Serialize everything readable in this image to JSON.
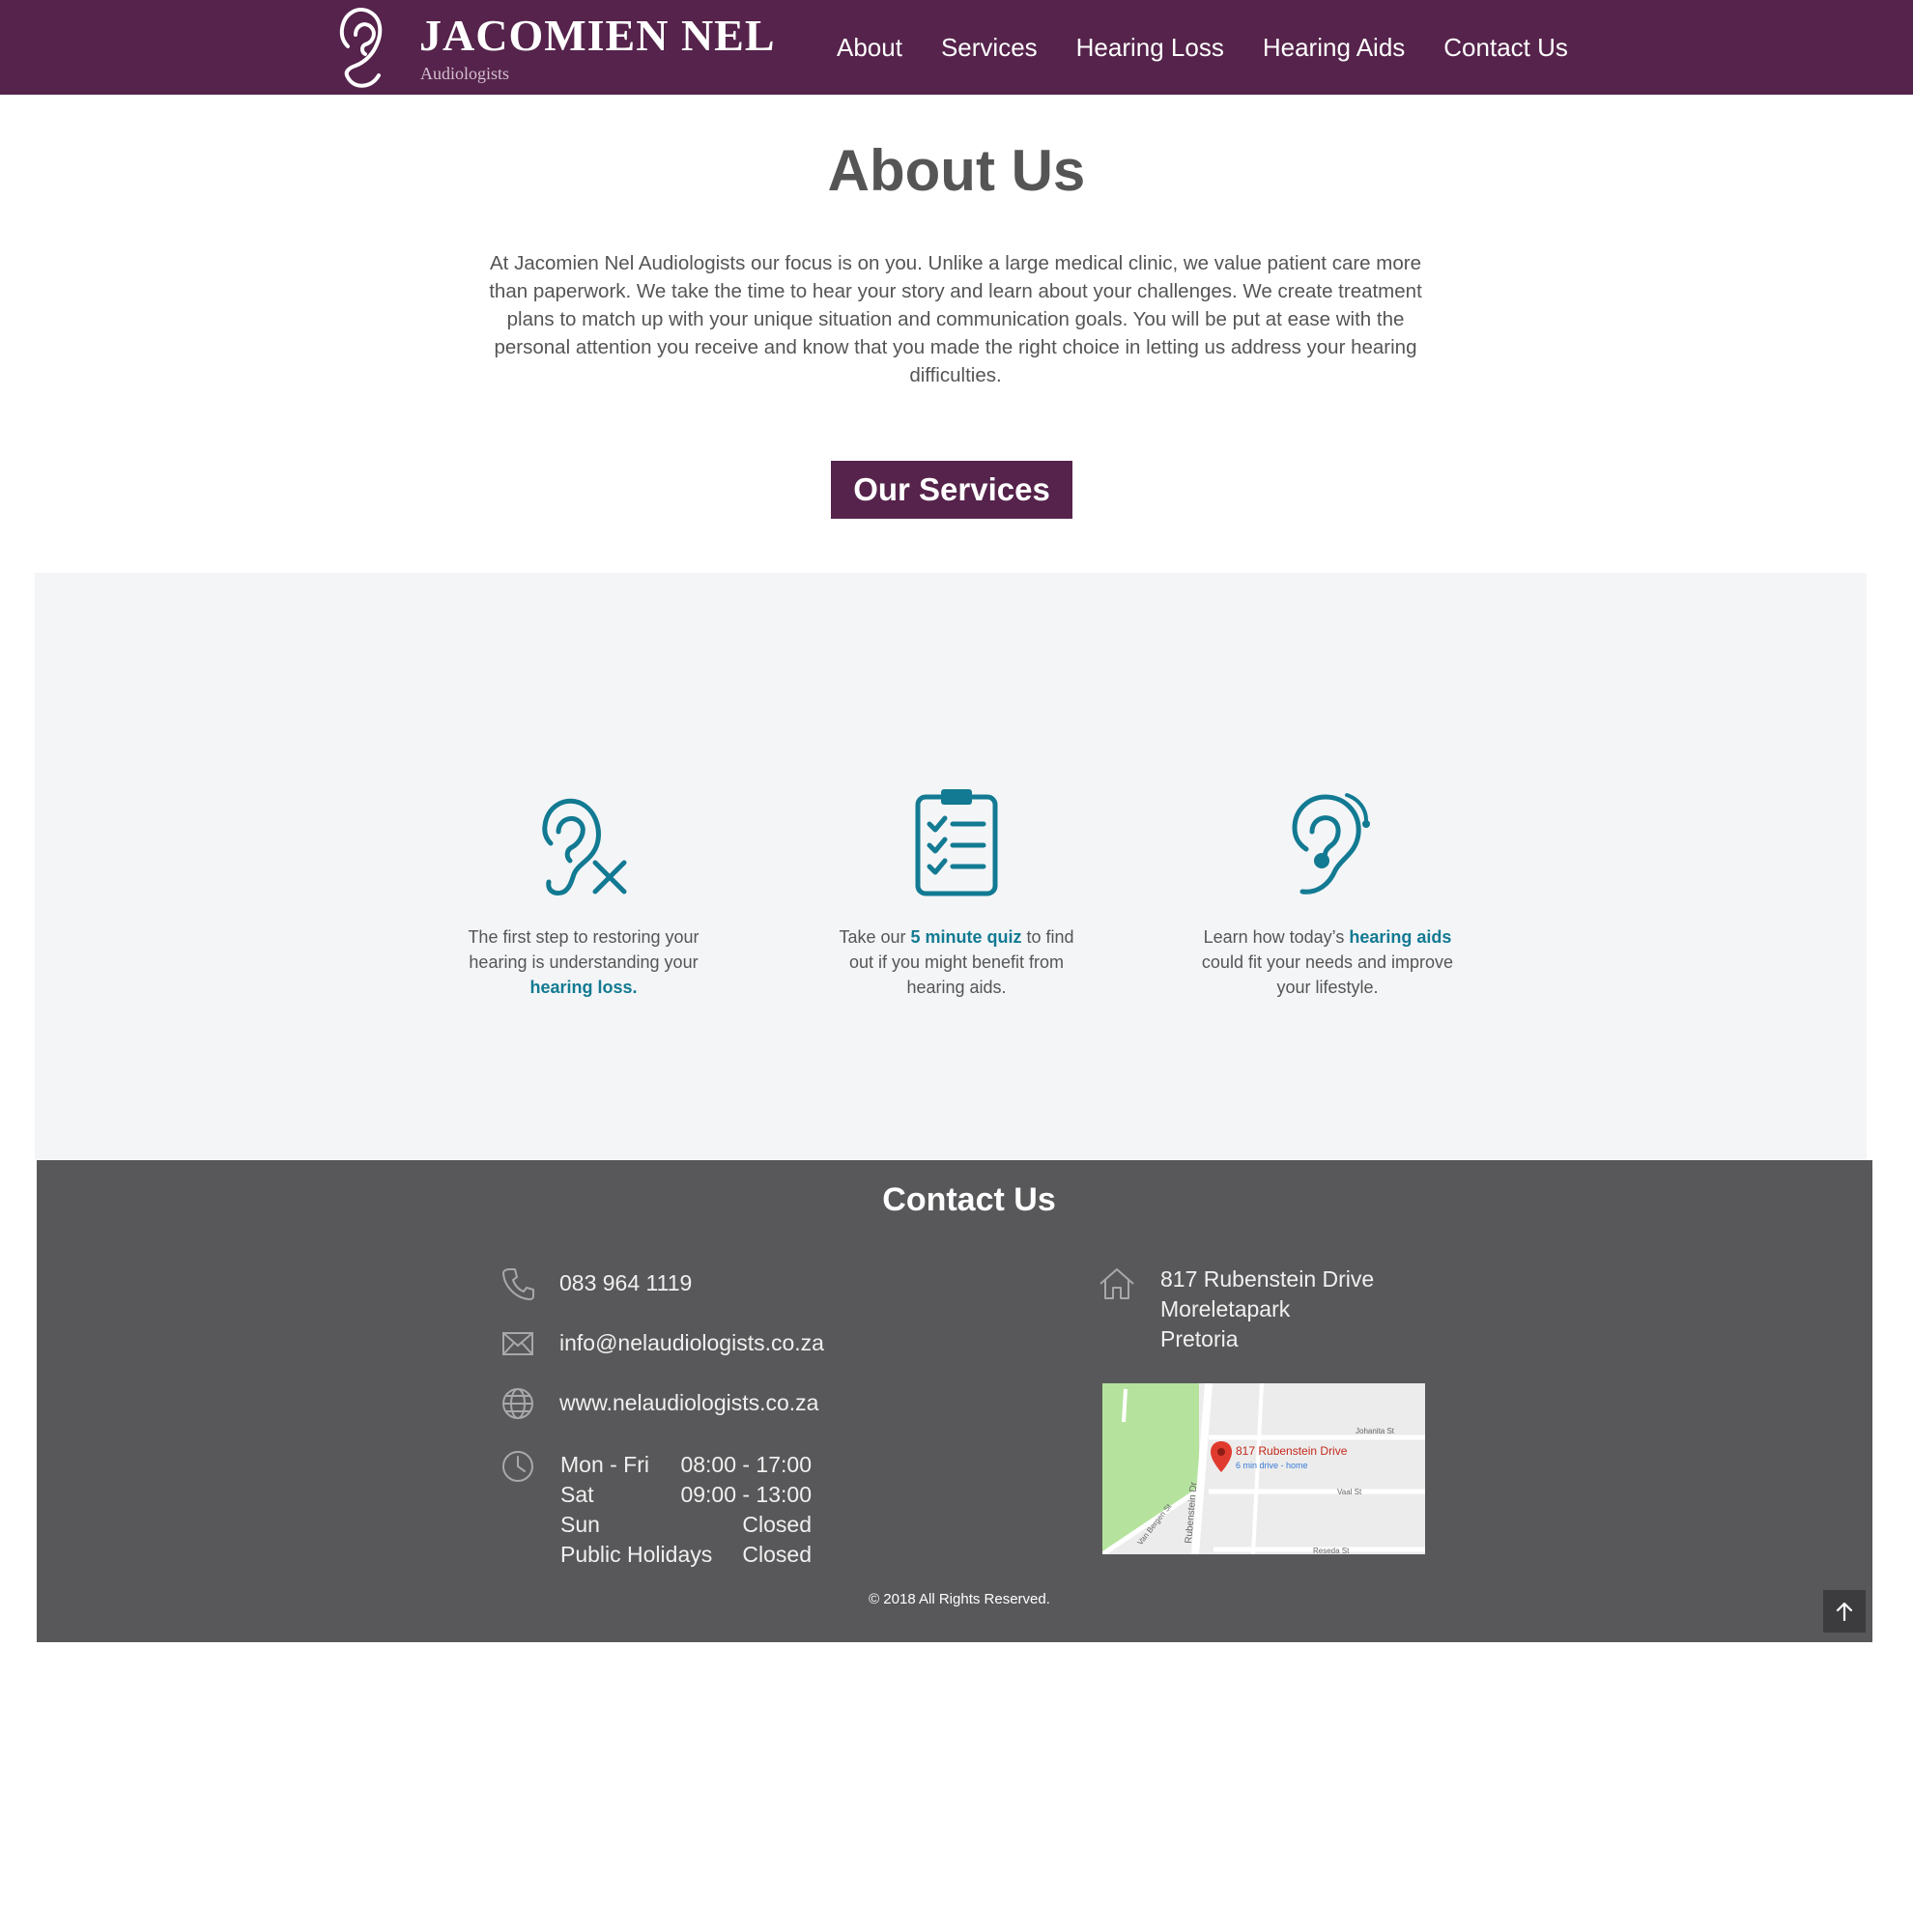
{
  "header": {
    "brand_name": "JACOMIEN NEL",
    "brand_sub": "Audiologists",
    "nav": [
      "About",
      "Services",
      "Hearing Loss",
      "Hearing Aids",
      "Contact Us"
    ]
  },
  "about": {
    "title": "About Us",
    "text": "At Jacomien Nel Audiologists our focus is on you. Unlike a large medical clinic, we value patient care more than paperwork. We take the time to hear your story and learn about your challenges. We create treatment plans to match up with your unique situation and communication goals. You will be put at ease with the personal attention you receive and know that you made the right choice in letting us address your hearing difficulties."
  },
  "services": {
    "heading": "Our Services",
    "items": [
      {
        "icon": "ear-cross-icon",
        "pre": "The first step to restoring your hearing is understanding your ",
        "link": "hearing loss.",
        "post": ""
      },
      {
        "icon": "clipboard-checklist-icon",
        "pre": "Take our ",
        "link": "5 minute quiz",
        "post": " to find out if you might benefit from hearing aids."
      },
      {
        "icon": "hearing-aid-ear-icon",
        "pre": "Learn how today’s ",
        "link": "hearing aids",
        "post": " could fit your needs and improve your lifestyle."
      }
    ]
  },
  "contact": {
    "title": "Contact Us",
    "phone": "083 964 1119",
    "email": "info@nelaudiologists.co.za",
    "website": "www.nelaudiologists.co.za",
    "hours": [
      {
        "day": "Mon - Fri",
        "time": "08:00 - 17:00"
      },
      {
        "day": "Sat",
        "time": "09:00 - 13:00"
      },
      {
        "day": "Sun",
        "time": "Closed"
      },
      {
        "day": "Public Holidays",
        "time": "Closed"
      }
    ],
    "address": [
      "817 Rubenstein Drive",
      "Moreletapark",
      "Pretoria"
    ],
    "map": {
      "pin_label": "817 Rubenstein Drive",
      "pin_sub": "6 min drive - home",
      "streets": [
        "Johanita St",
        "Vaal St",
        "Reseda St",
        "Van Bergen St",
        "Rubenstein Dr"
      ]
    }
  },
  "footer": {
    "copyright": "© 2018  All Rights Reserved."
  },
  "colors": {
    "brand": "#55234b",
    "accent": "#127a92",
    "footer": "#58585a",
    "panel": "#f4f5f7"
  }
}
